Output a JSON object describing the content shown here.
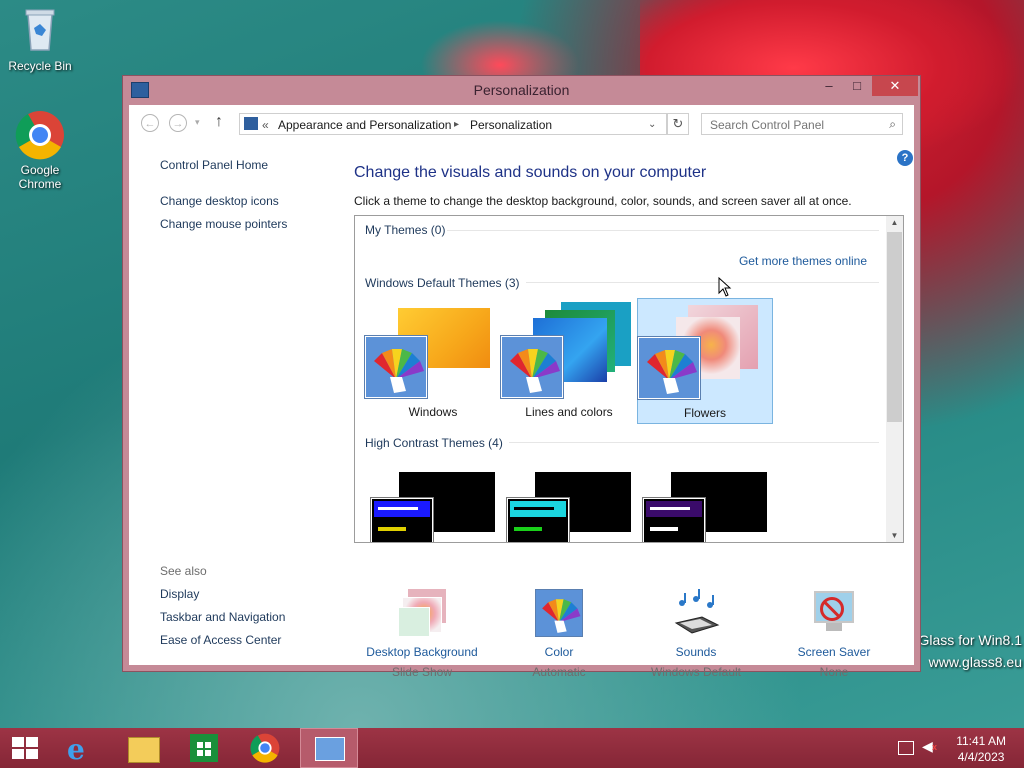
{
  "desktop": {
    "icons": [
      {
        "label": "Recycle Bin"
      },
      {
        "label": "Google Chrome"
      }
    ],
    "watermark_line1": "Glass for Win8.1",
    "watermark_line2": "www.glass8.eu"
  },
  "window": {
    "title": "Personalization",
    "controls": {
      "minimize": "–",
      "maximize": "□",
      "close": "✕"
    }
  },
  "navbar": {
    "breadcrumb_sep": "«",
    "breadcrumb": [
      "Appearance and Personalization",
      "Personalization"
    ],
    "search_placeholder": "Search Control Panel"
  },
  "left_pane": {
    "home": "Control Panel Home",
    "links": [
      "Change desktop icons",
      "Change mouse pointers"
    ],
    "see_also_title": "See also",
    "see_also": [
      "Display",
      "Taskbar and Navigation",
      "Ease of Access Center"
    ]
  },
  "main": {
    "heading": "Change the visuals and sounds on your computer",
    "subtitle": "Click a theme to change the desktop background, color, sounds, and screen saver all at once.",
    "my_themes": "My Themes (0)",
    "get_more": "Get more themes online",
    "default_themes": "Windows Default Themes (3)",
    "themes": [
      {
        "label": "Windows",
        "selected": false
      },
      {
        "label": "Lines and colors",
        "selected": false
      },
      {
        "label": "Flowers",
        "selected": true
      }
    ],
    "high_contrast": "High Contrast Themes (4)",
    "hc_colors": [
      {
        "bar": "#1a1aff",
        "line": "#e0d000"
      },
      {
        "bar": "#1bd6e0",
        "line": "#1ad01a"
      },
      {
        "bar": "#3a0b6a",
        "line": "#ffffff"
      }
    ]
  },
  "bottom": [
    {
      "label": "Desktop Background",
      "value": "Slide Show",
      "icon": "desktop-background-icon"
    },
    {
      "label": "Color",
      "value": "Automatic",
      "icon": "color-palette-icon"
    },
    {
      "label": "Sounds",
      "value": "Windows Default",
      "icon": "sounds-icon"
    },
    {
      "label": "Screen Saver",
      "value": "None",
      "icon": "screen-saver-icon"
    }
  ],
  "taskbar": {
    "time": "11:41 AM",
    "date": "4/4/2023"
  }
}
